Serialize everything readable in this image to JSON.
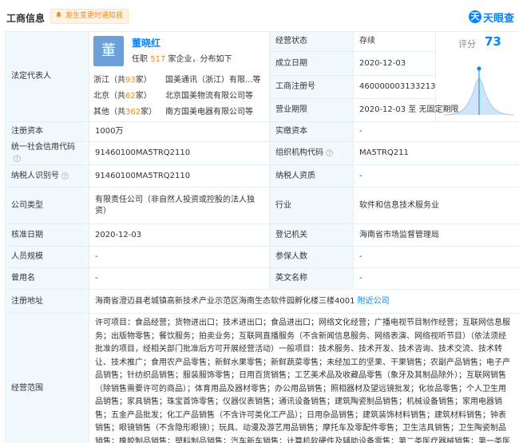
{
  "header": {
    "title": "工商信息",
    "notify_label": "发生变更时通知我",
    "brand_logo": "天",
    "brand_name": "天眼查"
  },
  "legal": {
    "label": "法定代表人",
    "avatar_char": "董",
    "name": "董晓红",
    "tenure_prefix": "任职 ",
    "tenure_count": "517",
    "tenure_suffix": " 家企业，分布如下",
    "groups": [
      {
        "region": "浙江（共",
        "count": "93",
        "unit": "家）",
        "company": "国美通讯（浙江）有限...等"
      },
      {
        "region": "北京（共",
        "count": "62",
        "unit": "家）",
        "company": "北京国美物流有限公司等"
      },
      {
        "region": "其他（共",
        "count": "362",
        "unit": "家）",
        "company": "南方国美电器有限公司等"
      }
    ]
  },
  "right_info": {
    "status_label": "经营状态",
    "status_value": "存续",
    "established_label": "成立日期",
    "established_value": "2020-12-03",
    "reg_no_label": "工商注册号",
    "reg_no_value": "460000003133213",
    "term_label": "营业期限",
    "term_value": "2020-12-03  至 无固定期限"
  },
  "score": {
    "label": "评分",
    "value": "73"
  },
  "rows": {
    "capital_label": "注册资本",
    "capital_value": "1000万",
    "paid_label": "实缴资本",
    "paid_value": "-",
    "credit_label": "统一社会信用代码",
    "credit_value": "91460100MA5TRQ2110",
    "org_label": "组织机构代码",
    "org_value": "MA5TRQ211",
    "tax_label": "纳税人识别号",
    "tax_value": "91460100MA5TRQ2110",
    "taxpayer_label": "纳税人资质",
    "taxpayer_value": "-",
    "type_label": "公司类型",
    "type_value": "有限责任公司（非自然人投资或控股的法人独资）",
    "industry_label": "行业",
    "industry_value": "软件和信息技术服务业",
    "approve_label": "核准日期",
    "approve_value": "2020-12-03",
    "authority_label": "登记机关",
    "authority_value": "海南省市场监督管理局",
    "staff_label": "人员规模",
    "staff_value": "-",
    "insured_label": "参保人数",
    "insured_value": "-",
    "former_label": "曾用名",
    "former_value": "-",
    "english_label": "英文名称",
    "english_value": "-",
    "address_label": "注册地址",
    "address_value": "海南省澄迈县老城镇高新技术产业示范区海南生态软件园孵化楼三楼4001",
    "nearby_link": "附近公司",
    "scope_label": "经营范围",
    "scope_value": "许可项目：食品经营；货物进出口；技术进出口；食品进出口；网络文化经营；广播电视节目制作经营；互联网信息服务；出版物零售；餐饮服务；拍卖业务；互联网直播服务（不含新闻信息服务、网络表演、网络视听节目）（依法须经批准的项目，经相关部门批准后方可开展经营活动）一般项目：技术服务、技术开发、技术咨询、技术交流、技术转让、技术推广；食用农产品零售；新鲜水果零售；新鲜蔬菜零售；未经加工的坚果、干果销售；农副产品销售；电子产品销售；针纺织品销售；服装服饰零售；日用百货销售；工艺美术品及收藏品零售（象牙及其制品除外）；互联网销售（除销售需要许可的商品）；体育用品及器材零售；办公用品销售；照相器材及望远镜批发；化妆品零售；个人卫生用品销售；家具销售；珠宝首饰零售；仪器仪表销售；通讯设备销售；建筑陶瓷制品销售；机械设备销售；家用电器销售；五金产品批发；化工产品销售（不含许可类化工产品）；日用杂品销售；建筑装饰材料销售；建筑材料销售；钟表销售；眼镜销售（不含隐形眼镜）；玩具、动漫及游艺用品销售；摩托车及零配件零售；卫生洁具销售；卫生陶瓷制品销售；橡胶制品销售；塑料制品销售；汽车新车销售；计算机软硬件及辅助设备零售；第二类医疗器械销售；第一类医疗器械销售"
  },
  "colors": {
    "accent": "#0084ff",
    "orange": "#f08a24",
    "label_bg": "#f2f9fc",
    "border": "#e4eef6"
  }
}
